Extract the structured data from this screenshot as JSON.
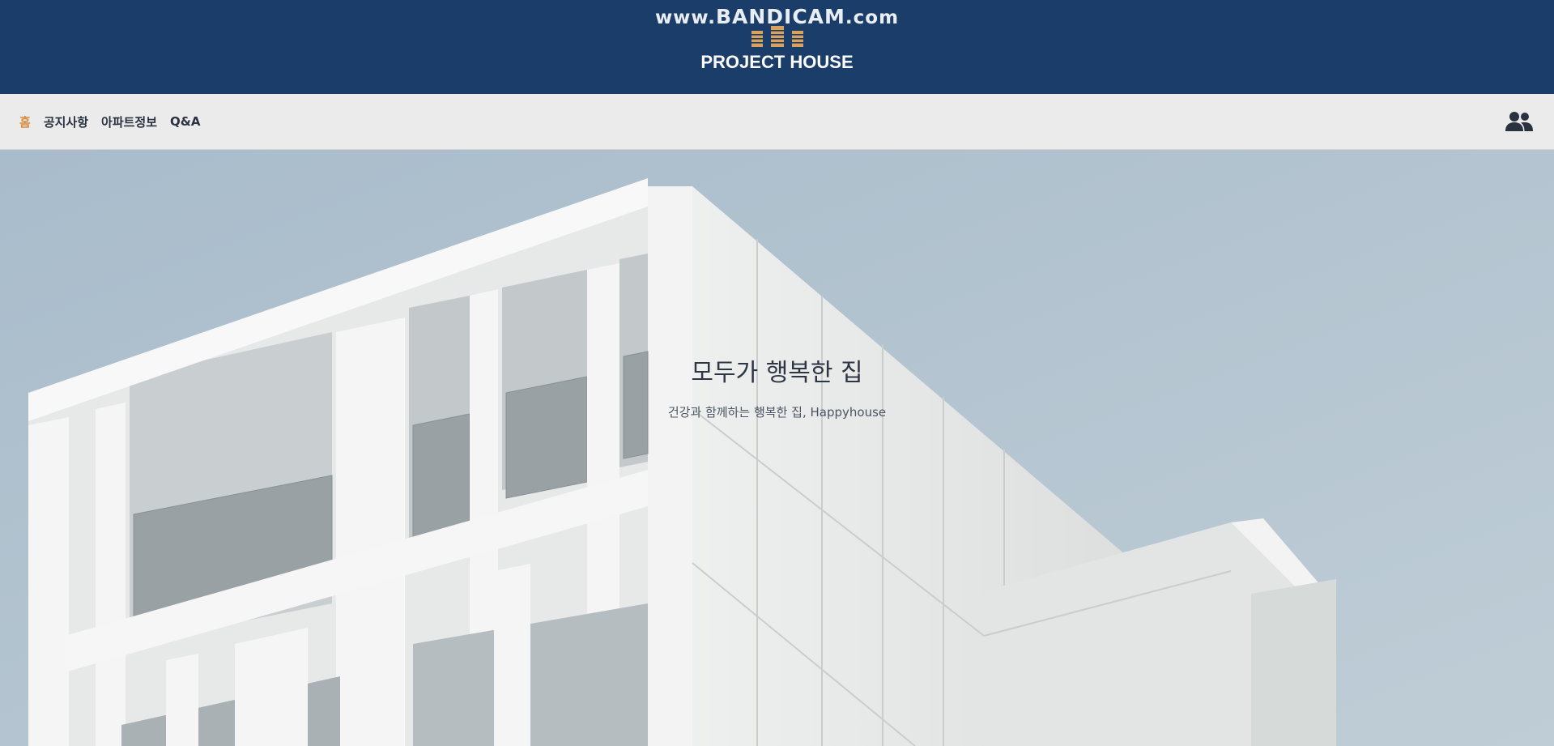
{
  "watermark": {
    "prefix": "www.",
    "brand": "BANDICAM",
    "suffix": ".com"
  },
  "logo": {
    "text": "PROJECT HOUSE",
    "icon": "building-icon"
  },
  "nav": {
    "items": [
      {
        "label": "홈",
        "active": true
      },
      {
        "label": "공지사항",
        "active": false
      },
      {
        "label": "아파트정보",
        "active": false
      },
      {
        "label": "Q&A",
        "active": false
      }
    ],
    "user_icon": "users-icon"
  },
  "hero": {
    "title": "모두가 행복한 집",
    "subtitle": "건강과 함께하는 행복한 집, Happyhouse"
  },
  "colors": {
    "header_bg": "#1b3d6a",
    "nav_bg": "#ebebeb",
    "active_nav": "#d98a3d",
    "sky": "#b2c2ce"
  }
}
